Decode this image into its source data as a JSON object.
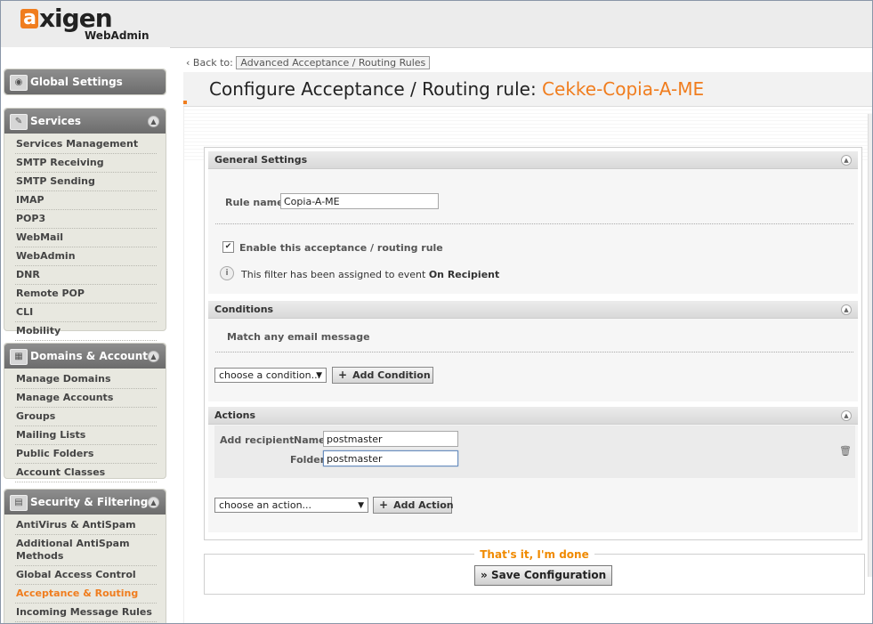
{
  "brand": {
    "logo_text": "axigen",
    "sub": "WebAdmin"
  },
  "sidebar": {
    "global": {
      "title": "Global Settings"
    },
    "services": {
      "title": "Services",
      "items": [
        "Services Management",
        "SMTP Receiving",
        "SMTP Sending",
        "IMAP",
        "POP3",
        "WebMail",
        "WebAdmin",
        "DNR",
        "Remote POP",
        "CLI",
        "Mobility"
      ]
    },
    "domains": {
      "title": "Domains & Accounts",
      "items": [
        "Manage Domains",
        "Manage Accounts",
        "Groups",
        "Mailing Lists",
        "Public Folders",
        "Account Classes"
      ]
    },
    "security": {
      "title": "Security & Filtering",
      "items": [
        "AntiVirus & AntiSpam",
        "Additional AntiSpam Methods",
        "Global Access Control",
        "Acceptance & Routing",
        "Incoming Message Rules"
      ],
      "active_index": 3
    }
  },
  "back": {
    "label": "Back to:",
    "link": "Advanced Acceptance / Routing Rules"
  },
  "page_title": {
    "prefix": "Configure Acceptance / Routing rule:",
    "rule_name": "Cekke-Copia-A-ME"
  },
  "general": {
    "title": "General Settings",
    "rule_name_label": "Rule name",
    "rule_name_value": "Copia-A-ME",
    "enable_label": "Enable this acceptance / routing rule",
    "enable_checked": true,
    "info_prefix": "This filter has been assigned to event",
    "info_event": "On Recipient"
  },
  "conditions": {
    "title": "Conditions",
    "match_text": "Match any email message",
    "select_value": "choose a condition...",
    "add_button": "Add Condition"
  },
  "actions": {
    "title": "Actions",
    "action_label": "Add recipient",
    "name_label": "Name",
    "name_value": "postmaster",
    "folder_label": "Folder",
    "folder_value": "postmaster",
    "select_value": "choose an action...",
    "add_button": "Add Action"
  },
  "done": {
    "text": "That's it, I'm done",
    "save_button": "Save Configuration"
  }
}
